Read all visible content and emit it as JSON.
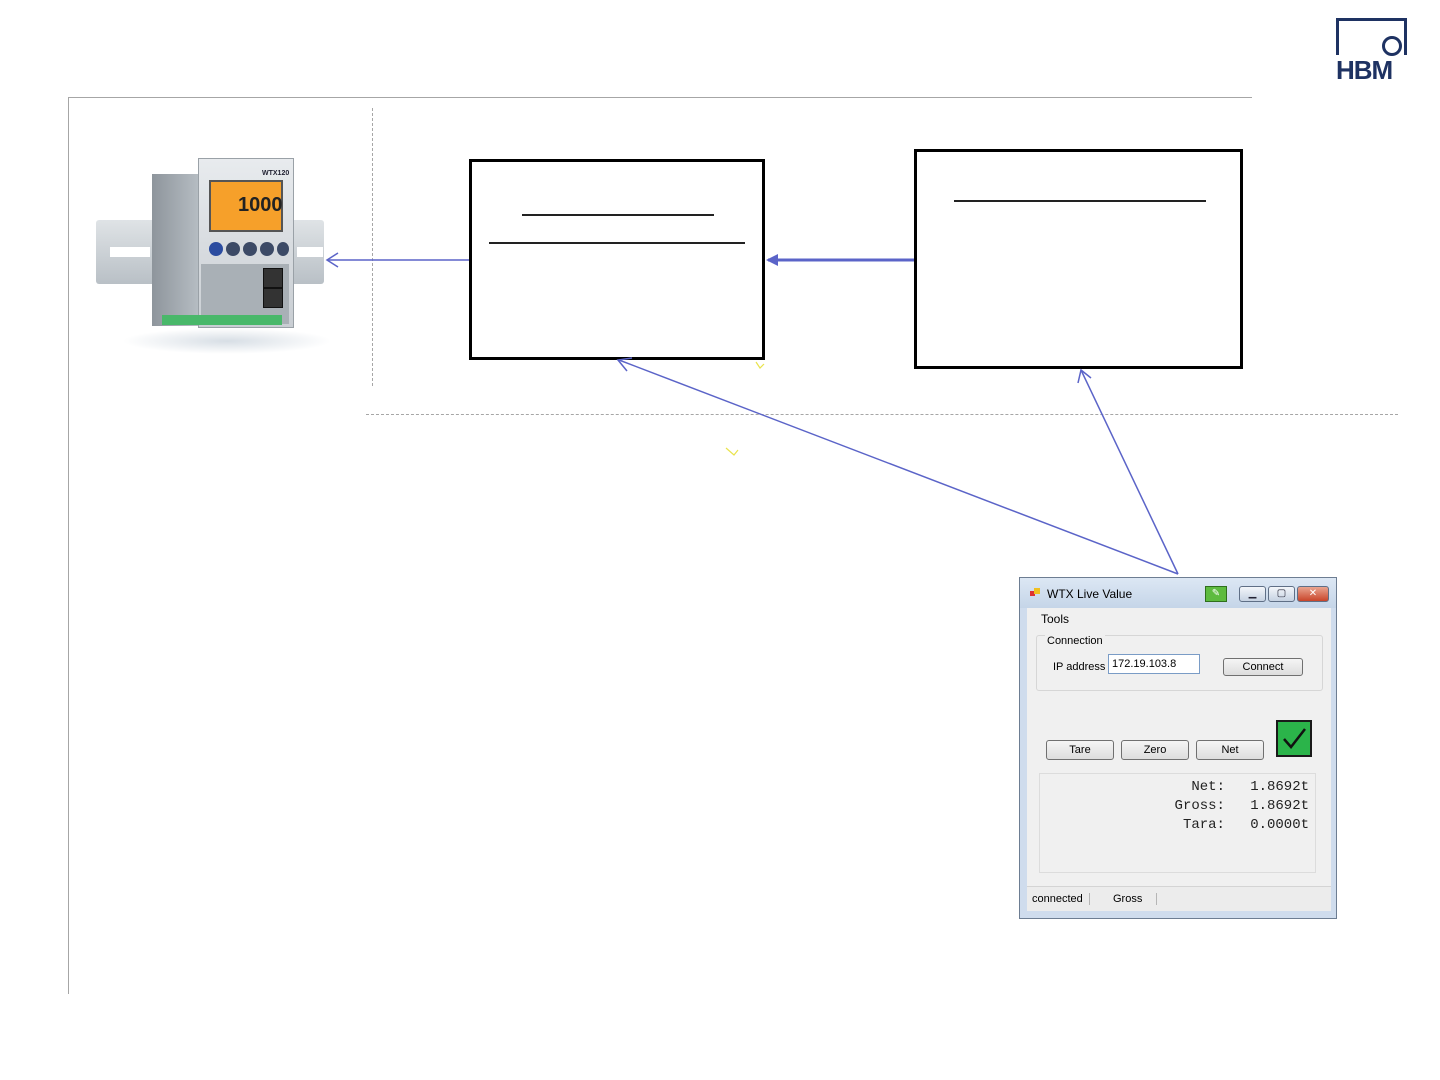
{
  "logo": {
    "text": "HBM",
    "color": "#1e3262"
  },
  "device": {
    "brand": "WTX120",
    "display_value": "1000"
  },
  "colors": {
    "arrow": "#5b64c8",
    "box_border": "#000000",
    "status_ok": "#2bb44a"
  },
  "window": {
    "title": "WTX Live Value",
    "icons": {
      "app": "app-icon",
      "extra": "edit-icon",
      "minimize": "minimize-icon",
      "maximize": "maximize-icon",
      "close": "close-icon"
    },
    "menu": {
      "tools": "Tools"
    },
    "connection": {
      "group_label": "Connection",
      "ip_label": "IP address",
      "ip_value": "172.19.103.8",
      "connect_button": "Connect"
    },
    "buttons": {
      "tare": "Tare",
      "zero": "Zero",
      "net": "Net"
    },
    "status_indicator": "check-icon",
    "values": [
      {
        "label": "Net:",
        "value": "1.8692t"
      },
      {
        "label": "Gross:",
        "value": "1.8692t"
      },
      {
        "label": "Tara:",
        "value": "0.0000t"
      }
    ],
    "statusbar": {
      "connection": "connected",
      "mode": "Gross"
    }
  }
}
